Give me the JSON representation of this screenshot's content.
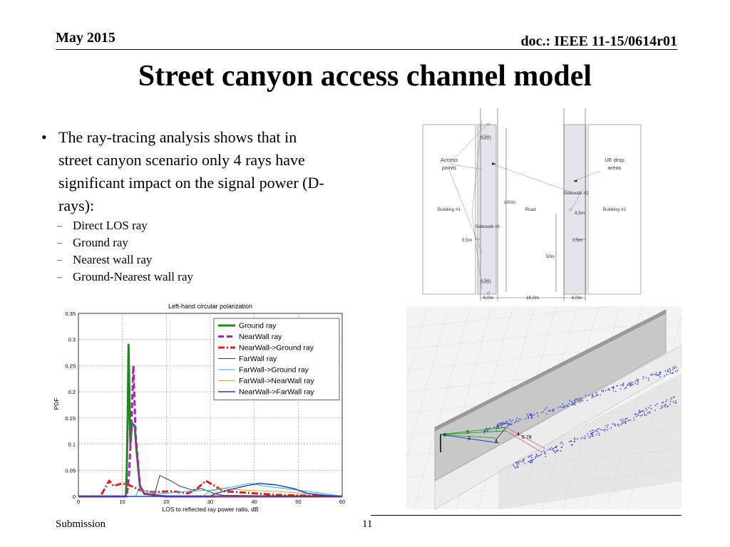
{
  "header": {
    "date": "May 2015",
    "doc": "doc.: IEEE 11-15/0614r01"
  },
  "title": "Street canyon access channel model",
  "bullet": {
    "lines": [
      "The ray-tracing analysis shows that in",
      "street canyon scenario only 4 rays have",
      "significant impact on the signal power (D-",
      "rays):"
    ],
    "subs": [
      "Direct LOS ray",
      "Ground ray",
      "Nearest wall ray",
      "Ground-Nearest wall ray"
    ]
  },
  "footer": {
    "left": "Submission",
    "page": "11"
  },
  "diagram": {
    "labels": {
      "access": [
        "Access",
        "points"
      ],
      "ue": [
        "UE drop",
        "areas"
      ],
      "sidewalk2": "Sidewalk #2",
      "sidewalk1": "Sidewalk #1",
      "building1": "Building #1",
      "building2": "Building #2",
      "road": "Road",
      "d_100m": "100m",
      "d_50m": "50m",
      "d_45_top": "4,5m",
      "d_45_right": "4,5m",
      "d_45_bottom": "4,5m",
      "d_05_left": "0,5m",
      "d_05_right": "0,5m",
      "d_6_left": "6,0m",
      "d_16": "16,0m",
      "d_6_right": "6,0m"
    }
  },
  "scene": {
    "labels": {
      "l678": "6 78",
      "l5": "5",
      "l8": "8",
      "l3": "3",
      "l4a": "4",
      "l4b": "4",
      "l6": "6"
    },
    "colors": {
      "dots": "#3b4fd8",
      "wall": "#c4c4c4"
    }
  },
  "chart_data": {
    "type": "line",
    "title": "Left-hand circular polarization",
    "xlabel": "LOS to reflected ray power ratio, dB",
    "ylabel": "PDF",
    "xlim": [
      0,
      60
    ],
    "ylim": [
      0,
      0.35
    ],
    "xticks": [
      0,
      10,
      20,
      30,
      40,
      50,
      60
    ],
    "xtick_labels": [
      "0",
      "10",
      "20",
      "30",
      "40",
      "50",
      "60"
    ],
    "yticks": [
      0,
      0.05,
      0.1,
      0.15,
      0.2,
      0.25,
      0.3,
      0.35
    ],
    "ytick_labels": [
      "0",
      "0.05",
      "0.1",
      "0.15",
      "0.2",
      "0.25",
      "0.3",
      "0.35"
    ],
    "grid": true,
    "legend_position": "top-right",
    "series": [
      {
        "name": "Ground ray",
        "color": "#1a8a1a",
        "width": 3,
        "dash": "",
        "points": [
          [
            0,
            0
          ],
          [
            10.8,
            0
          ],
          [
            11.0,
            0.05
          ],
          [
            11.2,
            0.15
          ],
          [
            11.4,
            0.29
          ],
          [
            11.6,
            0.2
          ],
          [
            11.8,
            0.1
          ],
          [
            12.2,
            0.14
          ],
          [
            12.8,
            0.135
          ],
          [
            13.2,
            0.09
          ],
          [
            14,
            0.02
          ],
          [
            15,
            0.005
          ],
          [
            20,
            0
          ],
          [
            60,
            0
          ]
        ]
      },
      {
        "name": "NearWall ray",
        "color": "#b020b8",
        "width": 3,
        "dash": "8,4",
        "points": [
          [
            0,
            0
          ],
          [
            11,
            0
          ],
          [
            11.5,
            0.04
          ],
          [
            12,
            0.12
          ],
          [
            12.5,
            0.25
          ],
          [
            13,
            0.12
          ],
          [
            14,
            0.02
          ],
          [
            15,
            0.005
          ],
          [
            20,
            0
          ],
          [
            60,
            0
          ]
        ]
      },
      {
        "name": "NearWall->Ground ray",
        "color": "#e02020",
        "width": 3,
        "dash": "9,3,2,3",
        "points": [
          [
            0,
            0
          ],
          [
            5,
            0
          ],
          [
            6,
            0.015
          ],
          [
            7,
            0.03
          ],
          [
            8,
            0.02
          ],
          [
            10,
            0.025
          ],
          [
            12,
            0.02
          ],
          [
            14,
            0.012
          ],
          [
            17,
            0.008
          ],
          [
            21,
            0.01
          ],
          [
            25,
            0.006
          ],
          [
            27,
            0.015
          ],
          [
            29,
            0.03
          ],
          [
            31,
            0.02
          ],
          [
            33,
            0.01
          ],
          [
            40,
            0.006
          ],
          [
            45,
            0.003
          ],
          [
            55,
            0.001
          ],
          [
            60,
            0
          ]
        ]
      },
      {
        "name": "FarWall ray",
        "color": "#3a3a3a",
        "width": 1,
        "dash": "",
        "points": [
          [
            0,
            0
          ],
          [
            17,
            0
          ],
          [
            17.5,
            0.01
          ],
          [
            18.5,
            0.04
          ],
          [
            21,
            0.03
          ],
          [
            23,
            0.02
          ],
          [
            26,
            0.012
          ],
          [
            28,
            0.015
          ],
          [
            31,
            0.005
          ],
          [
            33,
            0.002
          ],
          [
            60,
            0
          ]
        ]
      },
      {
        "name": "FarWall->Ground ray",
        "color": "#22b8cc",
        "width": 1,
        "dash": "",
        "points": [
          [
            0,
            0
          ],
          [
            13,
            0
          ],
          [
            13.5,
            0.01
          ],
          [
            14.5,
            0.012
          ],
          [
            16,
            0.008
          ],
          [
            20,
            0.006
          ],
          [
            25,
            0.01
          ],
          [
            30,
            0.012
          ],
          [
            35,
            0.018
          ],
          [
            39,
            0.025
          ],
          [
            42,
            0.02
          ],
          [
            47,
            0.015
          ],
          [
            52,
            0.01
          ],
          [
            58,
            0.003
          ],
          [
            60,
            0
          ]
        ]
      },
      {
        "name": "FarWall->NearWall ray",
        "color": "#c8b020",
        "width": 1,
        "dash": "",
        "points": [
          [
            0,
            0
          ],
          [
            28,
            0
          ],
          [
            30,
            0.01
          ],
          [
            33,
            0.015
          ],
          [
            38,
            0.012
          ],
          [
            44,
            0.01
          ],
          [
            50,
            0.007
          ],
          [
            56,
            0.003
          ],
          [
            60,
            0
          ]
        ]
      },
      {
        "name": "NearWall->FarWall ray",
        "color": "#1f3fd0",
        "width": 1.5,
        "dash": "",
        "points": [
          [
            0,
            0
          ],
          [
            30,
            0
          ],
          [
            31,
            0.005
          ],
          [
            34,
            0.012
          ],
          [
            38,
            0.02
          ],
          [
            41,
            0.025
          ],
          [
            45,
            0.022
          ],
          [
            49,
            0.015
          ],
          [
            52,
            0.006
          ],
          [
            56,
            0.002
          ],
          [
            60,
            0
          ]
        ]
      }
    ]
  }
}
